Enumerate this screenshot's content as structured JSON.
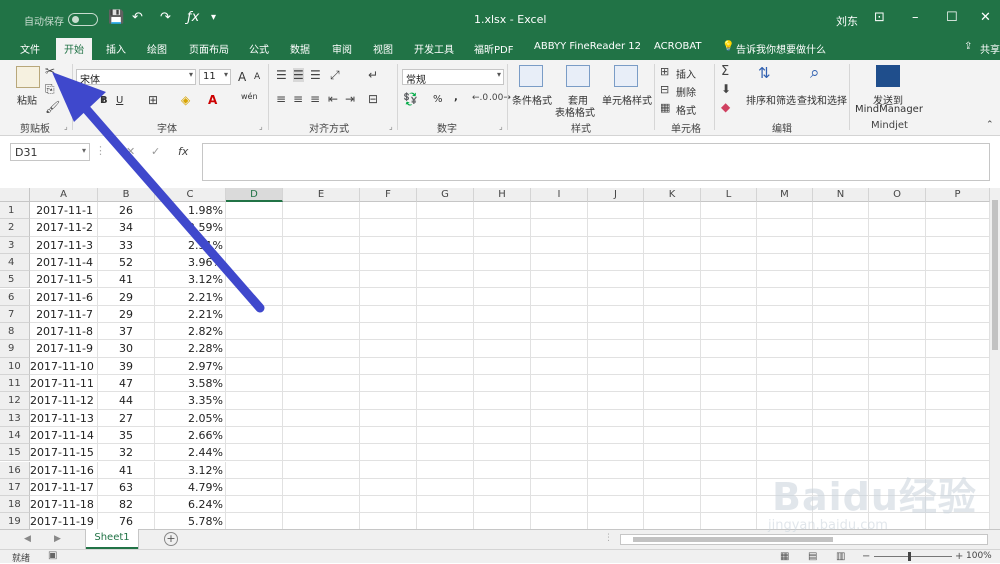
{
  "titlebar": {
    "autosave": "自动保存",
    "autosave_state": "关",
    "title": "1.xlsx  -  Excel",
    "user": "刘东"
  },
  "tabs": [
    "文件",
    "开始",
    "插入",
    "绘图",
    "页面布局",
    "公式",
    "数据",
    "审阅",
    "视图",
    "开发工具",
    "福昕PDF",
    "ABBYY FineReader 12",
    "ACROBAT",
    "告诉我你想要做什么",
    "共享"
  ],
  "ribbon": {
    "clipboard": {
      "paste": "粘贴",
      "label": "剪贴板"
    },
    "font": {
      "name": "宋体",
      "size": "11",
      "bold": "B",
      "italic": "I",
      "underline": "U",
      "label": "字体",
      "grow": "A",
      "shrink": "A",
      "wen": "wén"
    },
    "alignment": {
      "label": "对齐方式"
    },
    "number": {
      "format": "常规",
      "percent": "%",
      "comma": ",",
      "label": "数字"
    },
    "styles": {
      "conditional": "条件格式",
      "table": "套用",
      "table2": "表格格式",
      "cell_styles": "单元格样式",
      "label": "样式"
    },
    "cells": {
      "insert": "插入",
      "delete": "删除",
      "format": "格式",
      "label": "单元格"
    },
    "editing": {
      "sort": "排序和筛选",
      "find": "查找和选择",
      "label": "编辑"
    },
    "mindjet": {
      "send": "发送到",
      "app": "MindManager",
      "label": "Mindjet"
    }
  },
  "formula_bar": {
    "name_box": "D31",
    "fx": "fx",
    "value": ""
  },
  "columns": [
    "A",
    "B",
    "C",
    "D",
    "E",
    "F",
    "G",
    "H",
    "I",
    "J",
    "K",
    "L",
    "M",
    "N",
    "O",
    "P"
  ],
  "selected_column": "D",
  "rows": [
    {
      "n": "1",
      "a": "2017-11-1",
      "b": "26",
      "c": "1.98%"
    },
    {
      "n": "2",
      "a": "2017-11-2",
      "b": "34",
      "c": "2.59%"
    },
    {
      "n": "3",
      "a": "2017-11-3",
      "b": "33",
      "c": "2.51%"
    },
    {
      "n": "4",
      "a": "2017-11-4",
      "b": "52",
      "c": "3.96%"
    },
    {
      "n": "5",
      "a": "2017-11-5",
      "b": "41",
      "c": "3.12%"
    },
    {
      "n": "6",
      "a": "2017-11-6",
      "b": "29",
      "c": "2.21%"
    },
    {
      "n": "7",
      "a": "2017-11-7",
      "b": "29",
      "c": "2.21%"
    },
    {
      "n": "8",
      "a": "2017-11-8",
      "b": "37",
      "c": "2.82%"
    },
    {
      "n": "9",
      "a": "2017-11-9",
      "b": "30",
      "c": "2.28%"
    },
    {
      "n": "10",
      "a": "2017-11-10",
      "b": "39",
      "c": "2.97%"
    },
    {
      "n": "11",
      "a": "2017-11-11",
      "b": "47",
      "c": "3.58%"
    },
    {
      "n": "12",
      "a": "2017-11-12",
      "b": "44",
      "c": "3.35%"
    },
    {
      "n": "13",
      "a": "2017-11-13",
      "b": "27",
      "c": "2.05%"
    },
    {
      "n": "14",
      "a": "2017-11-14",
      "b": "35",
      "c": "2.66%"
    },
    {
      "n": "15",
      "a": "2017-11-15",
      "b": "32",
      "c": "2.44%"
    },
    {
      "n": "16",
      "a": "2017-11-16",
      "b": "41",
      "c": "3.12%"
    },
    {
      "n": "17",
      "a": "2017-11-17",
      "b": "63",
      "c": "4.79%"
    },
    {
      "n": "18",
      "a": "2017-11-18",
      "b": "82",
      "c": "6.24%"
    },
    {
      "n": "19",
      "a": "2017-11-19",
      "b": "76",
      "c": "5.78%"
    }
  ],
  "sheet_tabs": [
    "Sheet1"
  ],
  "status": {
    "ready": "就绪",
    "zoom": "100%"
  },
  "watermark": {
    "brand": "Baidu经验",
    "url": "jingyan.baidu.com"
  },
  "colors": {
    "accent": "#217346",
    "arrow": "#3f48cc"
  },
  "icons": [
    "cut-icon",
    "copy-icon",
    "format-painter-icon",
    "save-icon",
    "undo-icon",
    "redo-icon",
    "fx-icon",
    "lightbulb-icon",
    "share-icon"
  ]
}
